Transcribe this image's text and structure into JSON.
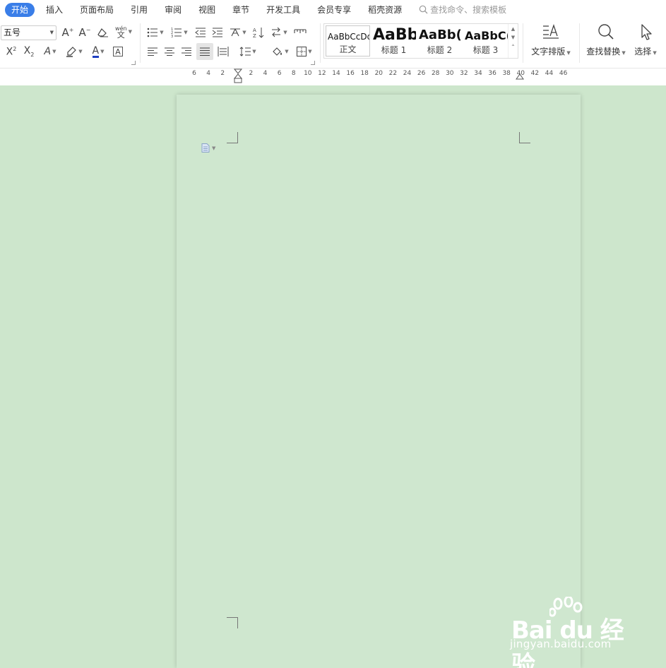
{
  "tabs": [
    {
      "label": "开始",
      "active": true
    },
    {
      "label": "插入"
    },
    {
      "label": "页面布局"
    },
    {
      "label": "引用"
    },
    {
      "label": "审阅"
    },
    {
      "label": "视图"
    },
    {
      "label": "章节"
    },
    {
      "label": "开发工具"
    },
    {
      "label": "会员专享"
    },
    {
      "label": "稻壳资源"
    }
  ],
  "search": {
    "placeholder": "查找命令、搜索模板"
  },
  "font": {
    "size": "五号",
    "phonetic": "wén"
  },
  "styles": [
    {
      "preview": "AaBbCcDd",
      "label": "正文"
    },
    {
      "preview": "AaBb",
      "label": "标题 1"
    },
    {
      "preview": "AaBb(",
      "label": "标题 2"
    },
    {
      "preview": "AaBbC(",
      "label": "标题 3"
    }
  ],
  "buttons": {
    "text_layout": "文字排版",
    "find_replace": "查找替换",
    "select": "选择"
  },
  "ruler": {
    "ticks": [
      "6",
      "4",
      "2",
      "2",
      "4",
      "6",
      "8",
      "10",
      "12",
      "14",
      "16",
      "18",
      "20",
      "22",
      "24",
      "26",
      "28",
      "30",
      "32",
      "34",
      "36",
      "38",
      "40",
      "42",
      "44",
      "46"
    ]
  },
  "watermark": {
    "logo_text": "Bai du 经验",
    "url": "jingyan.baidu.com"
  },
  "colors": {
    "accent": "#3a7ee8",
    "doc_background": "#cde6cc",
    "page_background": "#cfe7cf",
    "font_color_underline": "#1f3fbf"
  }
}
